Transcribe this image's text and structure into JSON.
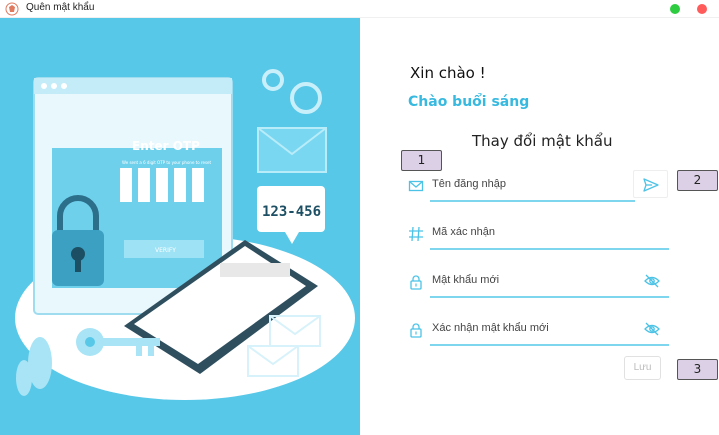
{
  "window": {
    "title": "Quên mật khẩu"
  },
  "illustration": {
    "otp_heading": "Enter OTP",
    "otp_sub": "We sent a 6 digit OTP to your phone to reset",
    "otp_button": "VERIFY",
    "otp_code": "123-456"
  },
  "main": {
    "hello": "Xin chào !",
    "greeting": "Chào buổi sáng",
    "form_title": "Thay đổi mật khẩu"
  },
  "form": {
    "username_placeholder": "Tên đăng nhập",
    "code_placeholder": "Mã xác nhận",
    "new_password_placeholder": "Mật khẩu mới",
    "confirm_password_placeholder": "Xác nhận mật khẩu mới",
    "save_label": "Lưu"
  },
  "annotations": {
    "badge1": "1",
    "badge2": "2",
    "badge3": "3"
  },
  "colors": {
    "accent": "#37b9e0",
    "illustration_bg": "#58c8e8",
    "input_underline": "#7ed5ee",
    "badge_bg": "#dcd0e6"
  }
}
